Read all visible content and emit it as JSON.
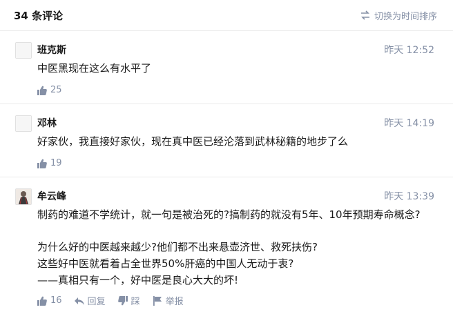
{
  "header": {
    "count_label": "34 条评论",
    "sort_label": "切换为时间排序"
  },
  "comments": [
    {
      "author": "班克斯",
      "time": "昨天 12:52",
      "lines": [
        "中医黑现在这么有水平了"
      ],
      "likes": "25"
    },
    {
      "author": "邓林",
      "time": "昨天 14:19",
      "lines": [
        "好家伙，我直接好家伙，现在真中医已经沦落到武林秘籍的地步了么"
      ],
      "likes": "19"
    },
    {
      "author": "牟云峰",
      "time": "昨天 13:39",
      "lines": [
        "制药的难道不学统计，就一句是被治死的?搞制药的就没有5年、10年预期寿命概念?",
        "为什么好的中医越来越少?他们都不出来悬壶济世、救死扶伤?",
        "这些好中医就看着占全世界50%肝癌的中国人无动于衷?",
        "——真相只有一个，好中医是良心大大的坏!"
      ],
      "likes": "16",
      "reply_label": "回复",
      "dislike_label": "踩",
      "report_label": "举报"
    }
  ],
  "colors": {
    "meta": "#8590a6",
    "text": "#1a1a1a",
    "divider": "#ebebeb"
  }
}
